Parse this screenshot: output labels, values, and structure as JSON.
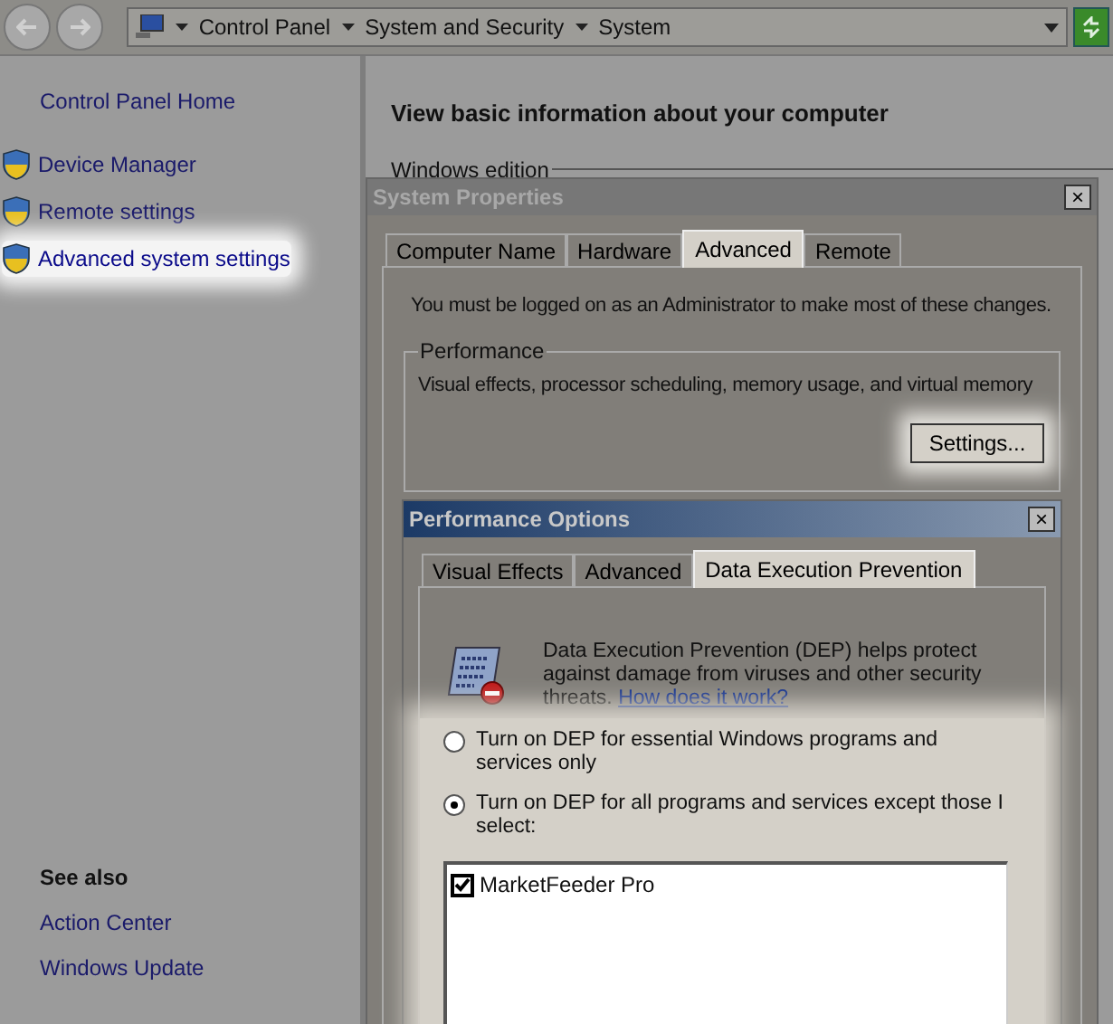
{
  "address_bar": {
    "crumbs": [
      "Control Panel",
      "System and Security",
      "System"
    ]
  },
  "sidebar": {
    "home": "Control Panel Home",
    "items": [
      {
        "label": "Device Manager",
        "highlighted": false
      },
      {
        "label": "Remote settings",
        "highlighted": false
      },
      {
        "label": "Advanced system settings",
        "highlighted": true
      }
    ],
    "see_also": {
      "title": "See also",
      "links": [
        "Action Center",
        "Windows Update"
      ]
    }
  },
  "main": {
    "heading": "View basic information about your computer",
    "section": "Windows edition"
  },
  "system_properties": {
    "title": "System Properties",
    "close": "×",
    "tabs": [
      {
        "label": "Computer Name",
        "selected": false
      },
      {
        "label": "Hardware",
        "selected": false
      },
      {
        "label": "Advanced",
        "selected": true
      },
      {
        "label": "Remote",
        "selected": false
      }
    ],
    "notice": "You must be logged on as an Administrator to make most of these changes.",
    "performance": {
      "legend": "Performance",
      "description": "Visual effects, processor scheduling, memory usage, and virtual memory",
      "button": "Settings..."
    }
  },
  "performance_options": {
    "title": "Performance Options",
    "close": "×",
    "tabs": [
      {
        "label": "Visual Effects",
        "selected": false
      },
      {
        "label": "Advanced",
        "selected": false
      },
      {
        "label": "Data Execution Prevention",
        "selected": true
      }
    ],
    "intro": "Data Execution Prevention (DEP) helps protect against damage from viruses and other security threats.",
    "link": "How does it work?",
    "options": [
      {
        "label": "Turn on DEP for essential Windows programs and services only",
        "selected": false
      },
      {
        "label": "Turn on DEP for all programs and services except those I select:",
        "selected": true
      }
    ],
    "programs": [
      {
        "label": "MarketFeeder Pro",
        "checked": true
      }
    ]
  }
}
